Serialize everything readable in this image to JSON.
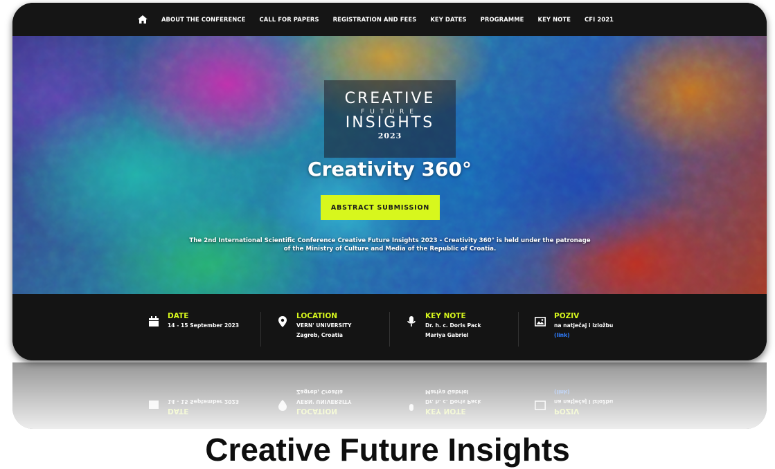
{
  "nav": {
    "home_icon": "home-icon",
    "items": [
      {
        "label": "ABOUT THE CONFERENCE"
      },
      {
        "label": "CALL FOR PAPERS"
      },
      {
        "label": "REGISTRATION AND FEES"
      },
      {
        "label": "KEY DATES"
      },
      {
        "label": "PROGRAMME"
      },
      {
        "label": "KEY NOTE"
      },
      {
        "label": "CFI 2021"
      }
    ]
  },
  "logo": {
    "line1": "CREATIVE",
    "line2": "FUTURE",
    "line3": "INSIGHTS",
    "year": "2023"
  },
  "hero": {
    "title": "Creativity 360°",
    "cta_label": "ABSTRACT SUBMISSION",
    "text": "The 2nd International Scientific Conference Creative Future Insights 2023 - Creativity 360° is held under the patronage of the Ministry of Culture and Media of the Republic of Croatia."
  },
  "info": {
    "date": {
      "title": "DATE",
      "line1": "14 - 15 September 2023",
      "icon": "calendar-icon"
    },
    "location": {
      "title": "LOCATION",
      "line1": "VERN' UNIVERSITY",
      "line2": "Zagreb, Croatia",
      "icon": "map-pin-icon"
    },
    "keynote": {
      "title": "KEY NOTE",
      "line1": "Dr. h. c. Doris Pack",
      "line2": "Mariya Gabriel",
      "icon": "microphone-icon"
    },
    "poziv": {
      "title": "POZIV",
      "line1": "na natječaj i izložbu",
      "link": "(link)",
      "icon": "image-icon"
    }
  },
  "footer": {
    "heading": "Creative Future Insights"
  },
  "colors": {
    "accent": "#d7f71d",
    "dark_bg": "#141414",
    "link": "#2f7dff"
  }
}
